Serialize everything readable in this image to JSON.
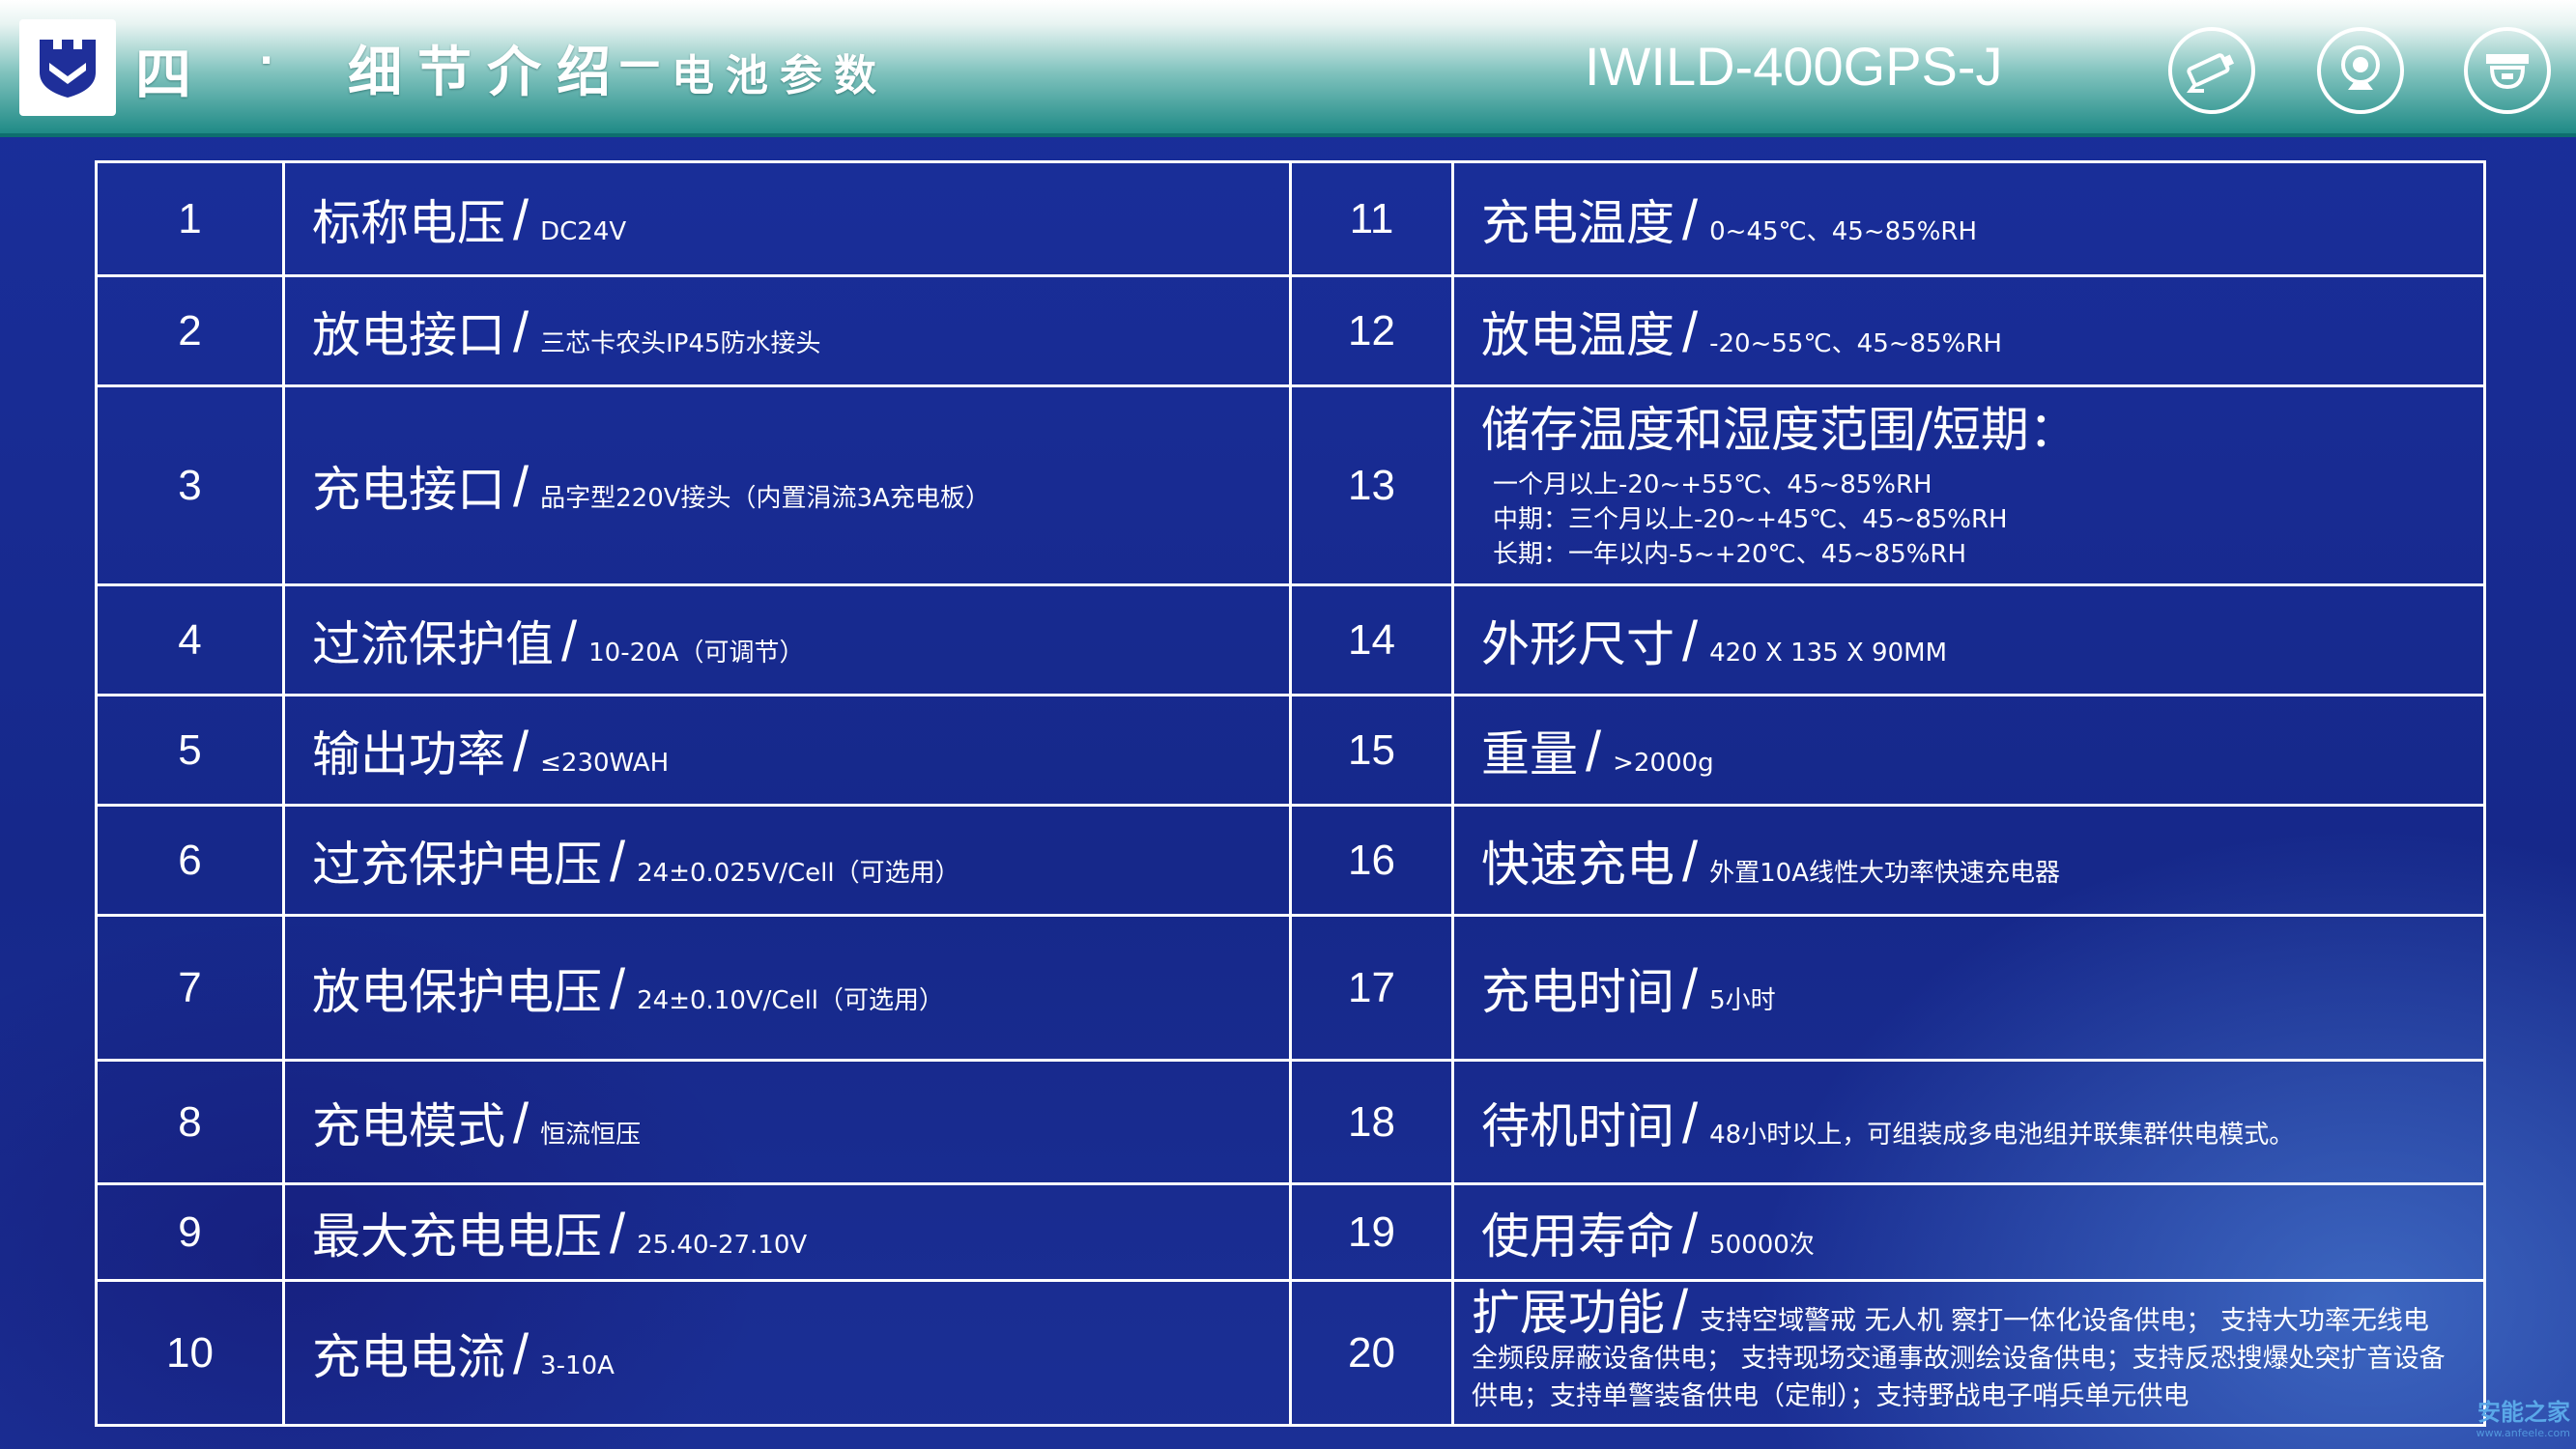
{
  "header": {
    "section_number": "四",
    "dot": "·",
    "title": "细节介绍",
    "separator": "—",
    "subtitle": "电池参数",
    "model": "IWILD-400GPS-J",
    "icons": [
      "shield-logo-icon",
      "camera-icon",
      "webcam-icon",
      "dome-camera-icon"
    ]
  },
  "table": {
    "left_rows": [
      {
        "num": "1",
        "label": "标称电压",
        "value": "DC24V"
      },
      {
        "num": "2",
        "label": "放电接口",
        "value": "三芯卡农头IP45防水接头"
      },
      {
        "num": "3",
        "label": "充电接口",
        "value": "品字型220V接头（内置涓流3A充电板）"
      },
      {
        "num": "4",
        "label": "过流保护值",
        "value": "10-20A（可调节）"
      },
      {
        "num": "5",
        "label": "输出功率",
        "value": "≤230WAH"
      },
      {
        "num": "6",
        "label": "过充保护电压",
        "value": "24±0.025V/Cell（可选用）"
      },
      {
        "num": "7",
        "label": "放电保护电压",
        "value": "24±0.10V/Cell（可选用）"
      },
      {
        "num": "8",
        "label": "充电模式",
        "value": "恒流恒压"
      },
      {
        "num": "9",
        "label": "最大充电电压",
        "value": "25.40-27.10V"
      },
      {
        "num": "10",
        "label": "充电电流",
        "value": "3-10A"
      }
    ],
    "right_rows": [
      {
        "num": "11",
        "label": "充电温度",
        "value": "0~45℃、45~85%RH"
      },
      {
        "num": "12",
        "label": "放电温度",
        "value": "-20~55℃、45~85%RH"
      },
      {
        "num": "13",
        "label": "储存温度和湿度范围/短期：",
        "lines": [
          "一个月以上-20~+55℃、45~85%RH",
          "中期：三个月以上-20~+45℃、45~85%RH",
          "长期：一年以内-5~+20℃、45~85%RH"
        ]
      },
      {
        "num": "14",
        "label": "外形尺寸",
        "value": "420 X 135 X 90MM"
      },
      {
        "num": "15",
        "label": "重量",
        "value": ">2000g"
      },
      {
        "num": "16",
        "label": "快速充电",
        "value": "外置10A线性大功率快速充电器"
      },
      {
        "num": "17",
        "label": "充电时间",
        "value": "5小时"
      },
      {
        "num": "18",
        "label": "待机时间",
        "value": "48小时以上，可组装成多电池组并联集群供电模式。"
      },
      {
        "num": "19",
        "label": "使用寿命",
        "value": "50000次"
      },
      {
        "num": "20",
        "label": "扩展功能",
        "value": "支持空域警戒 无人机 察打一体化设备供电； 支持大功率无线电全频段屏蔽设备供电； 支持现场交通事故测绘设备供电；支持反恐搜爆处突扩音设备供电；支持单警装备供电（定制）；支持野战电子哨兵单元供电"
      }
    ],
    "slash": "/"
  },
  "watermark": {
    "line1": "安能之家",
    "line2": "www.anfeele.com"
  },
  "colors": {
    "background": "#172a8e",
    "header_teal": "#1f8a86",
    "border": "#ffffff",
    "text": "#ffffff"
  }
}
